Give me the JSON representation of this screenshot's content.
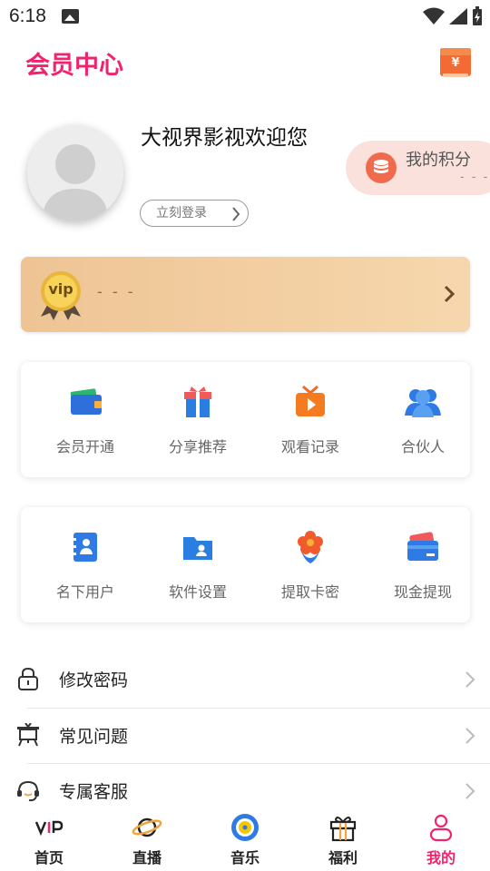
{
  "status_bar": {
    "time": "6:18"
  },
  "header": {
    "title": "会员中心",
    "wallet_icon": "wallet-yuan-icon",
    "wallet_symbol": "¥",
    "accent": "#f0246e"
  },
  "profile": {
    "welcome_text": "大视界影视欢迎您",
    "login_label": "立刻登录",
    "points_label": "我的积分",
    "points_value": "- - -"
  },
  "vip_banner": {
    "badge_text": "vip",
    "status_text": "- - -"
  },
  "card_primary": [
    {
      "label": "会员开通",
      "icon": "wallet-icon"
    },
    {
      "label": "分享推荐",
      "icon": "gift-box-icon"
    },
    {
      "label": "观看记录",
      "icon": "tv-play-icon"
    },
    {
      "label": "合伙人",
      "icon": "users-icon"
    }
  ],
  "card_secondary": [
    {
      "label": "名下用户",
      "icon": "contacts-book-icon"
    },
    {
      "label": "软件设置",
      "icon": "folder-user-icon"
    },
    {
      "label": "提取卡密",
      "icon": "flower-icon"
    },
    {
      "label": "现金提现",
      "icon": "cards-icon"
    }
  ],
  "menu": [
    {
      "label": "修改密码",
      "icon": "lock-icon"
    },
    {
      "label": "常见问题",
      "icon": "easel-icon"
    },
    {
      "label": "专属客服",
      "icon": "headset-icon"
    }
  ],
  "bottom_nav": [
    {
      "label": "首页",
      "icon": "vip-logo-icon"
    },
    {
      "label": "直播",
      "icon": "planet-icon"
    },
    {
      "label": "音乐",
      "icon": "music-disc-icon"
    },
    {
      "label": "福利",
      "icon": "gift-icon"
    },
    {
      "label": "我的",
      "icon": "person-icon",
      "active": true
    }
  ],
  "colors": {
    "primary_pink": "#f0246e",
    "vip_gold": "#eec494",
    "points_bg": "#fbe1dc",
    "points_icon": "#f06b4e"
  }
}
